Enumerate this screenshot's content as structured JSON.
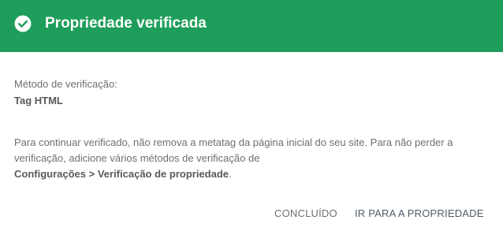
{
  "header": {
    "title": "Propriedade verificada",
    "background_color": "#1e9e5a",
    "icon": "check-circle-icon"
  },
  "verification": {
    "method_label": "Método de verificação:",
    "method_value": "Tag HTML"
  },
  "description": {
    "line1": "Para continuar verificado, não remova a metatag da página inicial do seu site. Para não perder a",
    "line2": "verificação, adicione vários métodos de verificação de",
    "settings_path": "Configurações > Verificação de propriedade",
    "trailing": "."
  },
  "actions": {
    "done_label": "CONCLUÍDO",
    "go_to_property_label": "IR PARA A PROPRIEDADE"
  }
}
